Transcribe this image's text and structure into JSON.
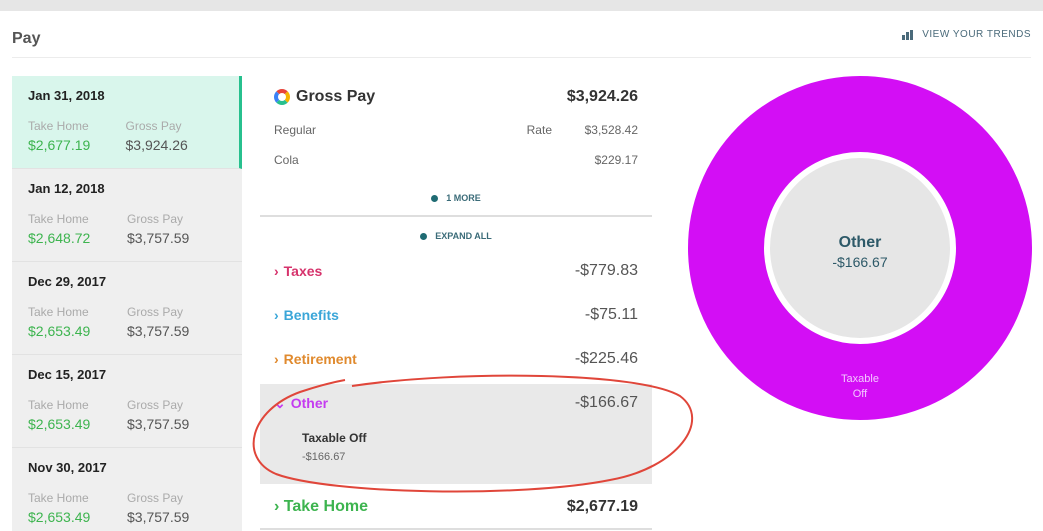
{
  "page": {
    "title": "Pay",
    "trends_link": "VIEW YOUR TRENDS"
  },
  "stubs": [
    {
      "date": "Jan 31, 2018",
      "take_home_label": "Take Home",
      "take_home": "$2,677.19",
      "gross_label": "Gross Pay",
      "gross": "$3,924.26",
      "selected": true
    },
    {
      "date": "Jan 12, 2018",
      "take_home_label": "Take Home",
      "take_home": "$2,648.72",
      "gross_label": "Gross Pay",
      "gross": "$3,757.59",
      "selected": false
    },
    {
      "date": "Dec 29, 2017",
      "take_home_label": "Take Home",
      "take_home": "$2,653.49",
      "gross_label": "Gross Pay",
      "gross": "$3,757.59",
      "selected": false
    },
    {
      "date": "Dec 15, 2017",
      "take_home_label": "Take Home",
      "take_home": "$2,653.49",
      "gross_label": "Gross Pay",
      "gross": "$3,757.59",
      "selected": false
    },
    {
      "date": "Nov 30, 2017",
      "take_home_label": "Take Home",
      "take_home": "$2,653.49",
      "gross_label": "Gross Pay",
      "gross": "$3,757.59",
      "selected": false
    }
  ],
  "detail": {
    "gross_title": "Gross Pay",
    "gross_amount": "$3,924.26",
    "regular_label": "Regular",
    "rate_label": "Rate",
    "regular_amount": "$3,528.42",
    "cola_label": "Cola",
    "cola_amount": "$229.17",
    "more_link": "1 MORE",
    "expand_link": "EXPAND ALL",
    "categories": [
      {
        "name": "Taxes",
        "amount": "-$779.83",
        "color": "#d6336c"
      },
      {
        "name": "Benefits",
        "amount": "-$75.11",
        "color": "#3aa6d8"
      },
      {
        "name": "Retirement",
        "amount": "-$225.46",
        "color": "#e08a2e"
      },
      {
        "name": "Other",
        "amount": "-$166.67",
        "color": "#c43cf0"
      }
    ],
    "other_item": {
      "name": "Taxable Off",
      "amount": "-$166.67"
    },
    "take_home_label": "Take Home",
    "take_home_amount": "$2,677.19"
  },
  "donut": {
    "center_title": "Other",
    "center_value": "-$166.67",
    "slice_label_line1": "Taxable",
    "slice_label_line2": "Off",
    "ring_color": "#d30ef5",
    "center_color": "#e6e6e6"
  },
  "colors": {
    "green": "#3db44f",
    "accent": "#27c08e",
    "annotation": "#e0463a"
  }
}
